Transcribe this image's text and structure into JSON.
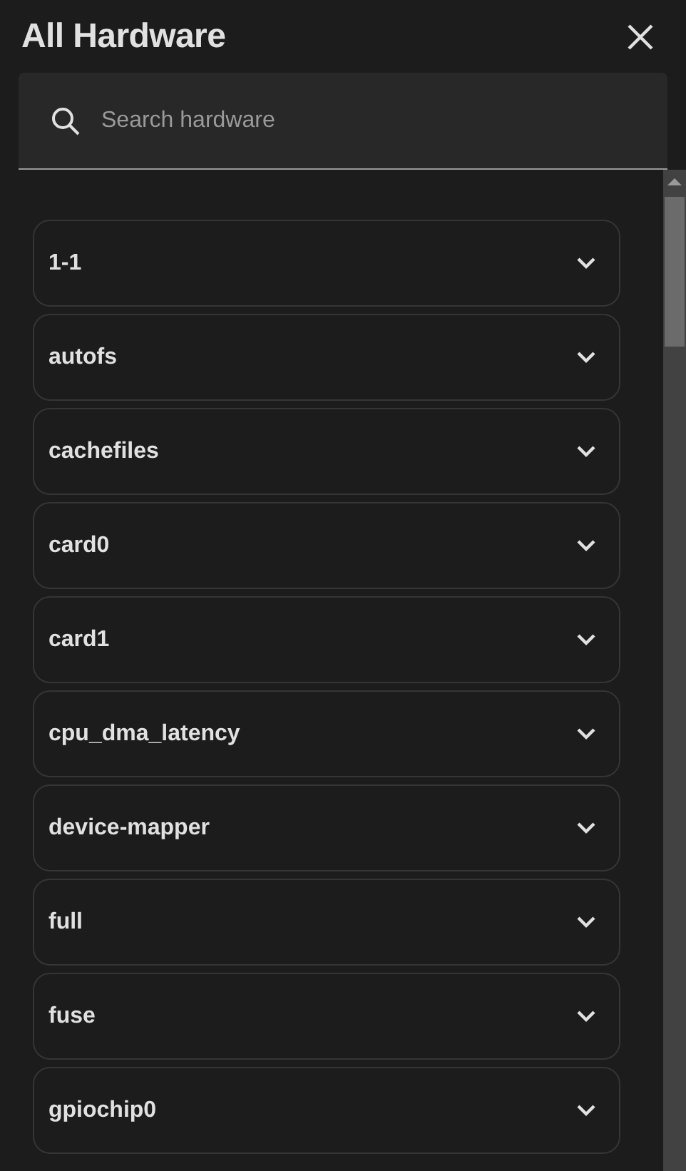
{
  "dialog": {
    "title": "All Hardware"
  },
  "search": {
    "placeholder": "Search hardware"
  },
  "devices": [
    {
      "name": "1-1",
      "expanded": false
    },
    {
      "name": "autofs",
      "expanded": false
    },
    {
      "name": "cachefiles",
      "expanded": false
    },
    {
      "name": "card0",
      "expanded": false
    },
    {
      "name": "card1",
      "expanded": false
    },
    {
      "name": "cpu_dma_latency",
      "expanded": false
    },
    {
      "name": "device-mapper",
      "expanded": false
    },
    {
      "name": "full",
      "expanded": false
    },
    {
      "name": "fuse",
      "expanded": false
    },
    {
      "name": "gpiochip0",
      "expanded": false
    }
  ]
}
